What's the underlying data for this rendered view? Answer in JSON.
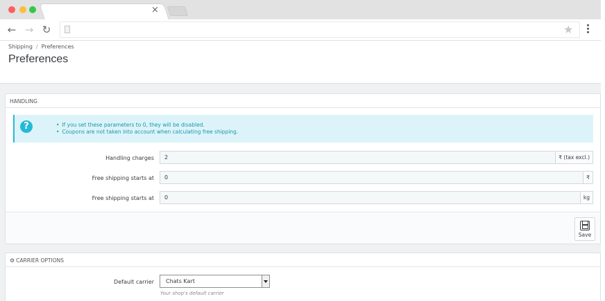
{
  "browser": {
    "controls": {
      "close_color": "#fc605c",
      "minimize_color": "#fdbc40",
      "maximize_color": "#34c84a"
    },
    "tab": {
      "close_label": "×"
    },
    "toolbar": {
      "back": "←",
      "forward": "→",
      "reload": "↻",
      "star": "★"
    }
  },
  "page": {
    "breadcrumb": {
      "items": [
        "Shipping",
        "Preferences"
      ],
      "separator": "/"
    },
    "title": "Preferences"
  },
  "handling": {
    "heading": "HANDLING",
    "info_items": [
      "If you set these parameters to 0, they will be disabled.",
      "Coupons are not taken into account when calculating free shipping."
    ],
    "fields": [
      {
        "label": "Handling charges",
        "value": "2",
        "addon": "₹ (tax excl.)"
      },
      {
        "label": "Free shipping starts at",
        "value": "0",
        "addon": "₹"
      },
      {
        "label": "Free shipping starts at",
        "value": "0",
        "addon": "kg"
      }
    ],
    "save_label": "Save"
  },
  "carrier_options": {
    "heading": "CARRIER OPTIONS",
    "default_carrier_label": "Default carrier",
    "default_carrier_value": "Chats Kart",
    "default_carrier_help": "Your shop's default carrier"
  }
}
